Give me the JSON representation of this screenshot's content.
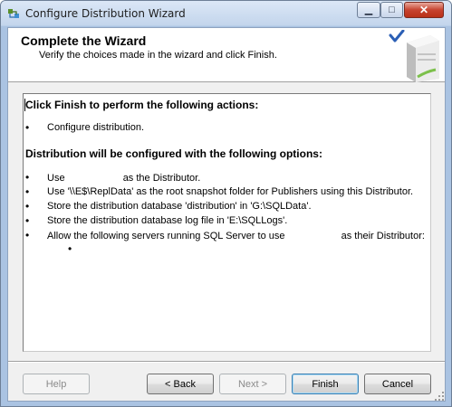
{
  "window": {
    "title": "Configure Distribution Wizard",
    "icons": {
      "app": "wizard-icon",
      "minimize": "minimize-icon",
      "maximize": "maximize-icon",
      "close": "close-icon"
    },
    "minimize_glyph": "▁",
    "maximize_glyph": "□",
    "close_glyph": "✕"
  },
  "header": {
    "title": "Complete the Wizard",
    "subtitle": "Verify the choices made in the wizard and click Finish.",
    "graphic": "server-check-icon"
  },
  "summary": {
    "heading_actions": "Click Finish to perform the following actions:",
    "actions": [
      "Configure distribution."
    ],
    "heading_options": "Distribution will be configured with the following options:",
    "options": [
      {
        "before": "Use",
        "after": "as the Distributor."
      },
      {
        "text": "Use '\\\\E$\\ReplData' as the root snapshot folder for Publishers using this Distributor."
      },
      {
        "text": "Store the distribution database 'distribution' in 'G:\\SQLData'."
      },
      {
        "text": "Store the distribution database log file in 'E:\\SQLLogs'."
      },
      {
        "before": "Allow the following servers running SQL Server to use",
        "after": "as their Distributor:"
      }
    ],
    "bullet": "•"
  },
  "buttons": {
    "help": "Help",
    "back": "< Back",
    "next": "Next >",
    "finish": "Finish",
    "cancel": "Cancel"
  },
  "colors": {
    "title_bar": "#c3d5ec",
    "close_button": "#c7432f",
    "dialog_background": "#f0f0f0",
    "accent_check": "#2b5fb5"
  }
}
